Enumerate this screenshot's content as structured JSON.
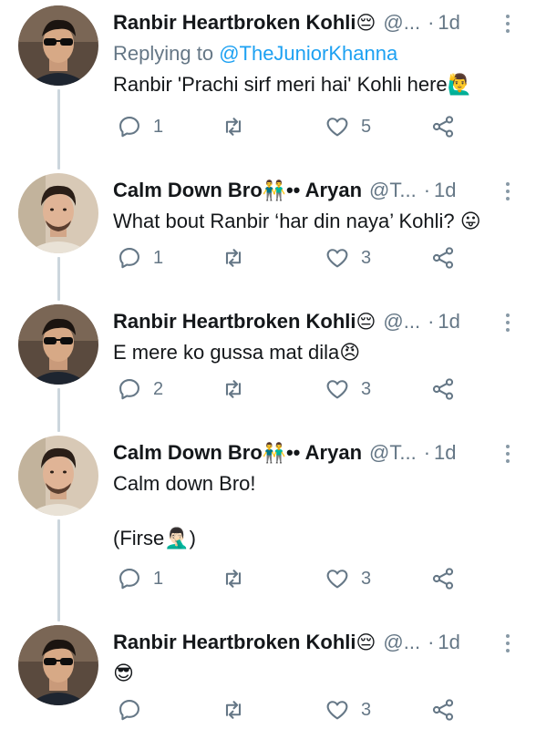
{
  "colors": {
    "text": "#14171a",
    "muted": "#657786",
    "link": "#1da1f2",
    "thread_line": "#ccd6dd"
  },
  "tweets": [
    {
      "name": "Ranbir Heartbroken Kohli",
      "name_emoji": "😔",
      "handle": "@...",
      "dot": "·",
      "time": "1d",
      "replying_prefix": "Replying to ",
      "replying_to": "@TheJuniorKhanna",
      "text": "Ranbir 'Prachi sirf meri hai' Kohli here🙋‍♂️",
      "reply_count": "1",
      "retweet_count": "",
      "like_count": "5"
    },
    {
      "name": "Calm Down Bro",
      "name_emoji": "👬",
      "name_suffix": " •• Aryan",
      "handle": "@T...",
      "dot": "·",
      "time": "1d",
      "text": "What bout Ranbir ‘har din naya’ Kohli? 😛",
      "reply_count": "1",
      "retweet_count": "",
      "like_count": "3"
    },
    {
      "name": "Ranbir Heartbroken Kohli",
      "name_emoji": "😔",
      "handle": "@...",
      "dot": "·",
      "time": "1d",
      "text": "E mere ko gussa mat dila😠",
      "reply_count": "2",
      "retweet_count": "",
      "like_count": "3"
    },
    {
      "name": "Calm Down Bro",
      "name_emoji": "👬",
      "name_suffix": " •• Aryan",
      "handle": "@T...",
      "dot": "·",
      "time": "1d",
      "text": "Calm down Bro!\n\n(Firse🤦🏻‍♂️)",
      "reply_count": "1",
      "retweet_count": "",
      "like_count": "3"
    },
    {
      "name": "Ranbir Heartbroken Kohli",
      "name_emoji": "😔",
      "handle": "@...",
      "dot": "·",
      "time": "1d",
      "text": "😎",
      "reply_count": "",
      "retweet_count": "",
      "like_count": "3"
    }
  ]
}
